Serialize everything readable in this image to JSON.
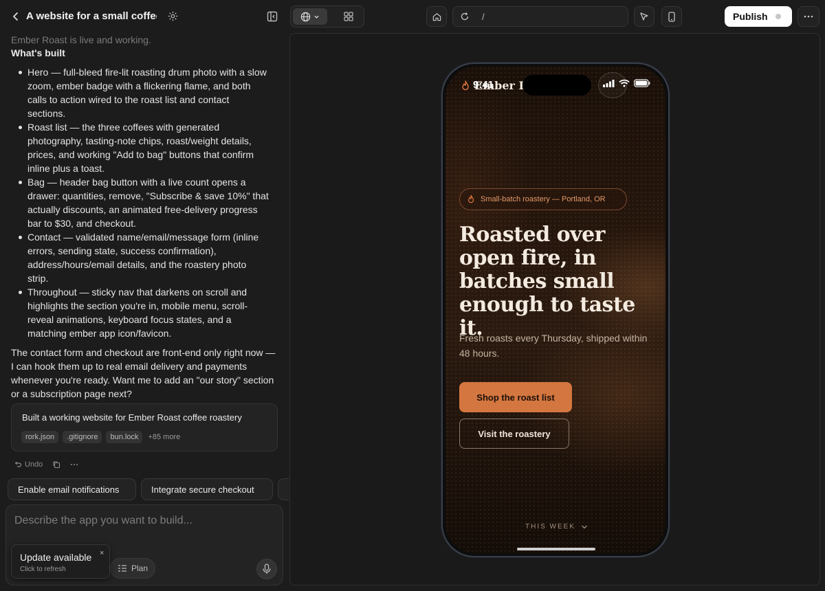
{
  "header": {
    "project_title": "A website for a small coffee r"
  },
  "chat": {
    "faded_line": "Ember Roast is live and working.",
    "section_heading": "What's built",
    "built_items": [
      "Hero — full-bleed fire-lit roasting drum photo with a slow zoom, ember badge with a flickering flame, and both calls to action wired to the roast list and contact sections.",
      "Roast list — the three coffees with generated photography, tasting-note chips, roast/weight details, prices, and working \"Add to bag\" buttons that confirm inline plus a toast.",
      "Bag — header bag button with a live count opens a drawer: quantities, remove, \"Subscribe & save 10%\" that actually discounts, an animated free-delivery progress bar to $30, and checkout.",
      "Contact — validated name/email/message form (inline errors, sending state, success confirmation), address/hours/email details, and the roastery photo strip.",
      "Throughout — sticky nav that darkens on scroll and highlights the section you're in, mobile menu, scroll-reveal animations, keyboard focus states, and a matching ember app icon/favicon."
    ],
    "closing": "The contact form and checkout are front-end only right now — I can hook them up to real email delivery and payments whenever you're ready. Want me to add an \"our story\" section or a subscription page next?"
  },
  "summary_card": {
    "title": "Built a working website for Ember Roast coffee roastery",
    "files": [
      "rork.json",
      ".gitignore",
      "bun.lock"
    ],
    "more": "+85 more"
  },
  "actions": {
    "undo": "Undo"
  },
  "suggestions": [
    "Enable email notifications",
    "Integrate secure checkout"
  ],
  "composer": {
    "placeholder": "Describe the app you want to build...",
    "plan_label": "Plan"
  },
  "update_toast": {
    "title": "Update available",
    "subtitle": "Click to refresh",
    "close": "×"
  },
  "toolbar": {
    "url": "/",
    "publish_label": "Publish"
  },
  "preview": {
    "status_time": "9:41",
    "brand": "Ember R",
    "badge": "Small-batch roastery — Portland, OR",
    "hero_title": "Roasted over open fire, in batches small enough to taste it.",
    "hero_sub": "Fresh roasts every Thursday, shipped within 48 hours.",
    "primary_cta": "Shop the roast list",
    "secondary_cta": "Visit the roastery",
    "scroll_hint": "THIS WEEK"
  },
  "colors": {
    "accent": "#d4763f",
    "background": "#1c1c1c",
    "badge_text": "#e39a6a"
  }
}
